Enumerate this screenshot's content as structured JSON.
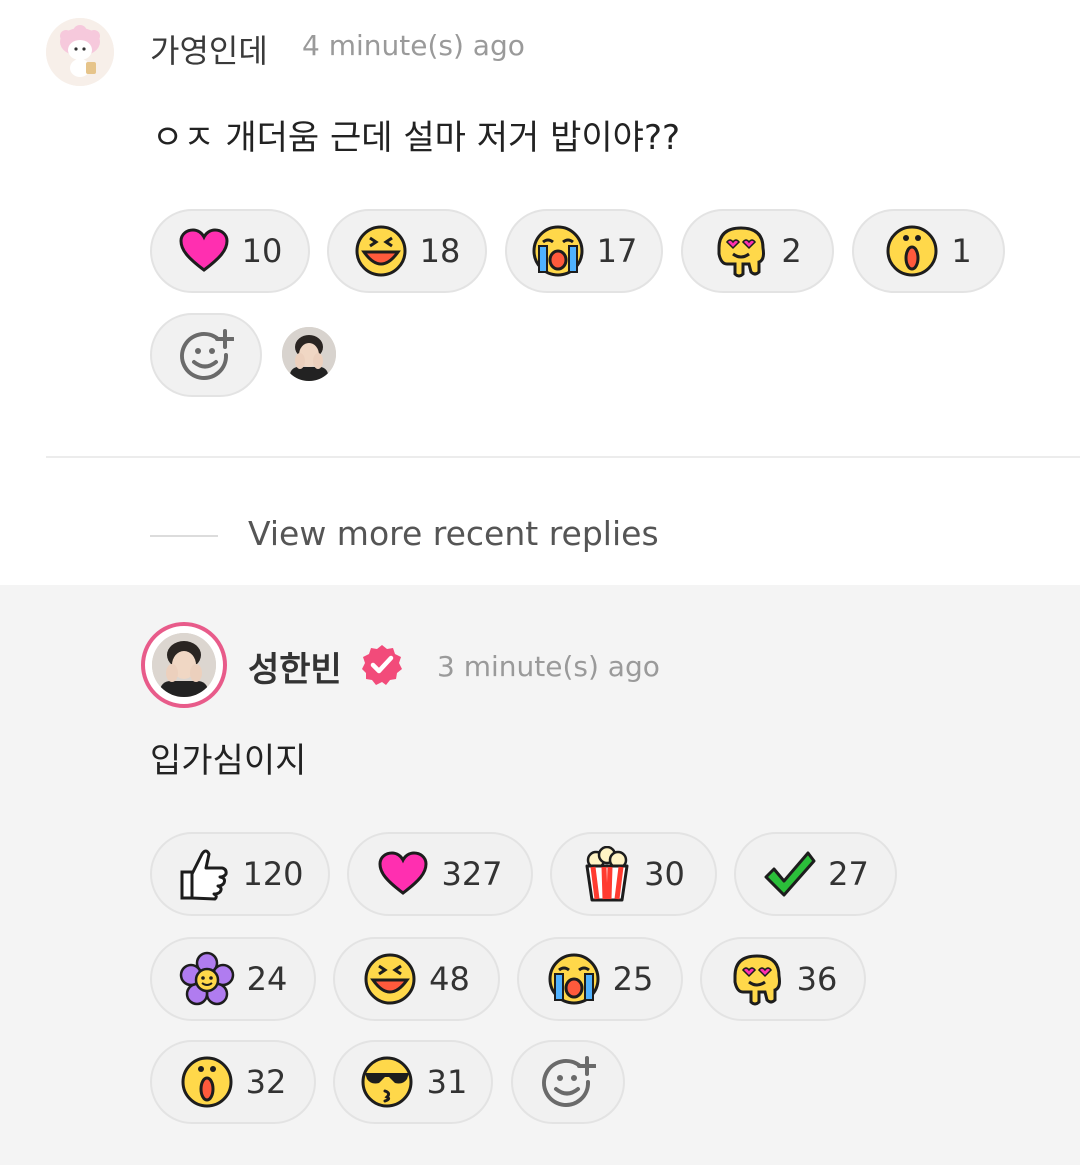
{
  "comment": {
    "username": "가영인데",
    "timestamp": "4 minute(s) ago",
    "text": "ㅇㅈ 개더움 근데 설마 저거 밥이야??",
    "reactions": [
      {
        "icon": "heart-icon",
        "count": "10"
      },
      {
        "icon": "laughing-face-icon",
        "count": "18"
      },
      {
        "icon": "crying-face-icon",
        "count": "17"
      },
      {
        "icon": "melting-love-face-icon",
        "count": "2"
      },
      {
        "icon": "shocked-face-icon",
        "count": "1"
      }
    ],
    "add_reaction_icon": "add-reaction-icon"
  },
  "view_more": {
    "label": "View more recent replies"
  },
  "reply": {
    "username": "성한빈",
    "verified_icon": "verified-badge-icon",
    "timestamp": "3 minute(s) ago",
    "text": "입가심이지",
    "reactions": [
      {
        "icon": "thumbs-up-icon",
        "count": "120"
      },
      {
        "icon": "heart-icon",
        "count": "327"
      },
      {
        "icon": "popcorn-icon",
        "count": "30"
      },
      {
        "icon": "checkmark-icon",
        "count": "27"
      },
      {
        "icon": "flower-icon",
        "count": "24"
      },
      {
        "icon": "laughing-face-icon",
        "count": "48"
      },
      {
        "icon": "crying-face-icon",
        "count": "25"
      },
      {
        "icon": "melting-love-face-icon",
        "count": "36"
      },
      {
        "icon": "shocked-face-icon",
        "count": "32"
      },
      {
        "icon": "cool-kiss-face-icon",
        "count": "31"
      }
    ],
    "add_reaction_icon": "add-reaction-icon"
  },
  "colors": {
    "accent_pink": "#e85b8a",
    "heart": "#ff2fb0",
    "emoji_yellow": "#ffd84a",
    "emoji_red": "#ff5a3c",
    "check_green": "#2bbf3a",
    "flower_purple": "#b07cf0"
  }
}
